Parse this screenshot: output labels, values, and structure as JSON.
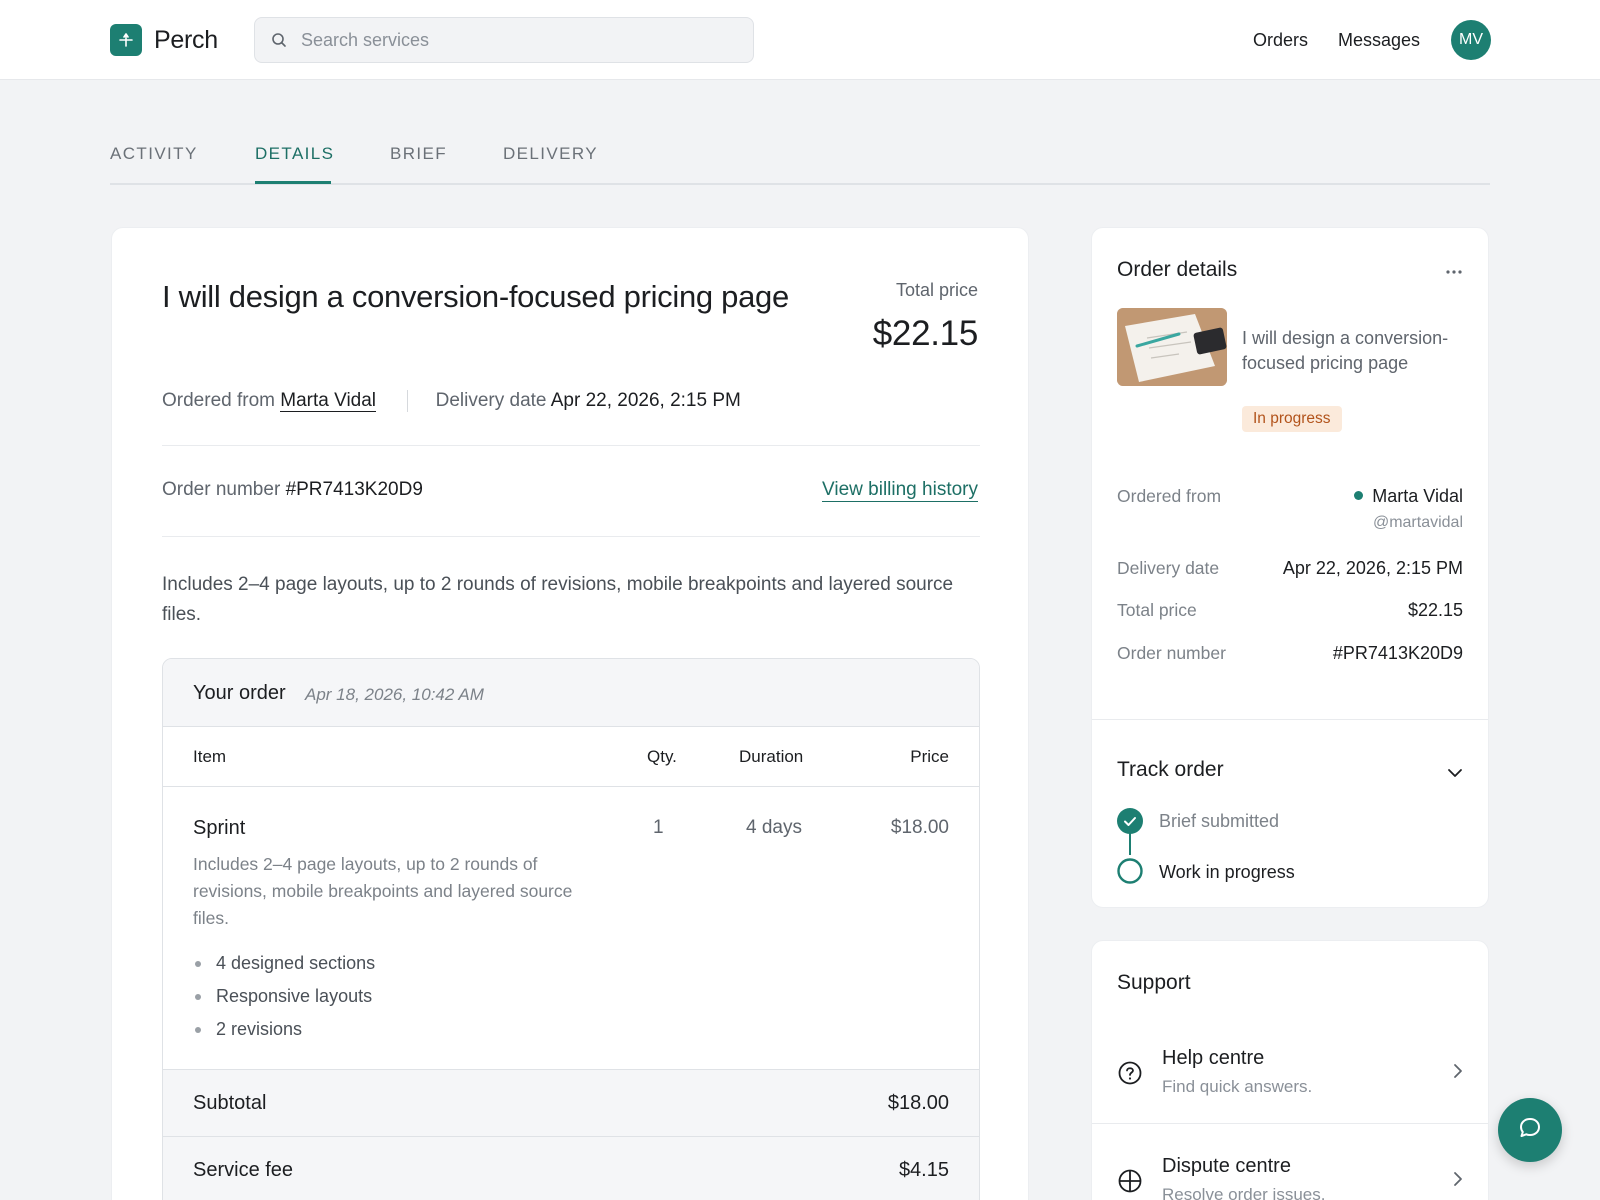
{
  "header": {
    "brand": "Perch",
    "search_placeholder": "Search services",
    "nav": [
      "Orders",
      "Messages"
    ],
    "avatar_initials": "MV",
    "brand_color": "#1d7f72"
  },
  "tabs": [
    {
      "label": "ACTIVITY",
      "active": false
    },
    {
      "label": "DETAILS",
      "active": true
    },
    {
      "label": "BRIEF",
      "active": false
    },
    {
      "label": "DELIVERY",
      "active": false
    }
  ],
  "order": {
    "title": "I will design a conversion-focused pricing page",
    "total_label": "Total price",
    "total_value": "$22.15",
    "ordered_from_label": "Ordered from",
    "seller": "Marta Vidal",
    "delivery_label": "Delivery date",
    "delivery_date": "Apr 22, 2026, 2:15 PM",
    "order_number_label": "Order number",
    "order_number": "#PR7413K20D9",
    "billing_link": "View billing history",
    "description": "Includes 2–4 page layouts, up to 2 rounds of revisions, mobile breakpoints and layered source files.",
    "your_order": {
      "title": "Your order",
      "date": "Apr 18, 2026, 10:42 AM",
      "columns": [
        "Item",
        "Qty.",
        "Duration",
        "Price"
      ],
      "item": {
        "name": "Sprint",
        "description": "Includes 2–4 page layouts, up to 2 rounds of revisions, mobile breakpoints and layered source files.",
        "qty": "1",
        "duration": "4 days",
        "price": "$18.00",
        "features": [
          "4 designed sections",
          "Responsive layouts",
          "2 revisions"
        ]
      },
      "subtotal_label": "Subtotal",
      "subtotal": "$18.00",
      "service_fee_label": "Service fee",
      "service_fee": "$4.15"
    }
  },
  "side": {
    "title": "Order details",
    "gig_title": "I will design a conversion-focused pricing page",
    "status": "In progress",
    "ordered_from_label": "Ordered from",
    "seller": "Marta Vidal",
    "seller_handle": "@martavidal",
    "delivery_label": "Delivery date",
    "delivery_date": "Apr 22, 2026, 2:15 PM",
    "total_label": "Total price",
    "total": "$22.15",
    "order_number_label": "Order number",
    "order_number": "#PR7413K20D9",
    "track_title": "Track order",
    "steps": [
      {
        "label": "Brief submitted",
        "done": true
      },
      {
        "label": "Work in progress",
        "done": false
      }
    ]
  },
  "support": {
    "title": "Support",
    "items": [
      {
        "title": "Help centre",
        "subtitle": "Find quick answers.",
        "icon": "question-circle-icon"
      },
      {
        "title": "Dispute centre",
        "subtitle": "Resolve order issues.",
        "icon": "lifebuoy-icon"
      }
    ]
  }
}
